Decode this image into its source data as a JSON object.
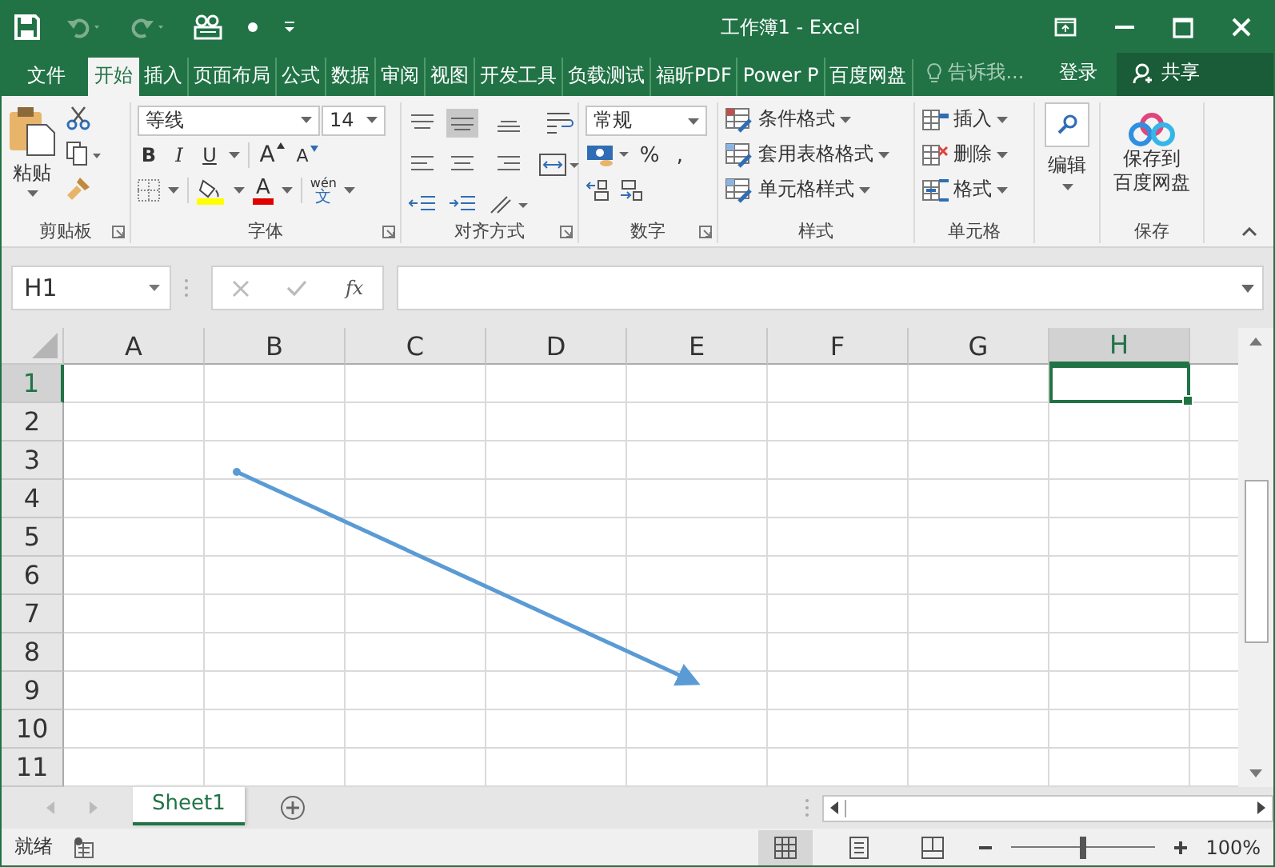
{
  "window": {
    "title": "工作簿1 - Excel"
  },
  "menu_tabs": [
    {
      "label": "文件",
      "selected": false
    },
    {
      "label": "开始",
      "selected": true
    },
    {
      "label": "插入",
      "selected": false
    },
    {
      "label": "页面布局",
      "selected": false
    },
    {
      "label": "公式",
      "selected": false
    },
    {
      "label": "数据",
      "selected": false
    },
    {
      "label": "审阅",
      "selected": false
    },
    {
      "label": "视图",
      "selected": false
    },
    {
      "label": "开发工具",
      "selected": false
    },
    {
      "label": "负载测试",
      "selected": false
    },
    {
      "label": "福昕PDF",
      "selected": false
    },
    {
      "label": "Power P",
      "selected": false
    },
    {
      "label": "百度网盘",
      "selected": false
    }
  ],
  "tell_me": {
    "placeholder": "告诉我..."
  },
  "sign_in": "登录",
  "share": "共享",
  "ribbon": {
    "paste": "粘贴",
    "clipboard_label": "剪贴板",
    "font_name": "等线",
    "font_size": "14",
    "font_styles": [
      "B",
      "I",
      "U"
    ],
    "grow_font": "A",
    "shrink_font": "A",
    "font_color": "A",
    "phonetic_top": "wén",
    "phonetic_bottom": "文",
    "font_label": "字体",
    "alignment_label": "对齐方式",
    "number_format": "常规",
    "percent": "%",
    "comma": ",",
    "number_label": "数字",
    "styles": [
      "条件格式",
      "套用表格格式",
      "单元格样式"
    ],
    "styles_label": "样式",
    "cells": [
      "插入",
      "删除",
      "格式"
    ],
    "cells_label": "单元格",
    "editing": "编辑",
    "save_lines": [
      "保存到",
      "百度网盘"
    ],
    "save_label": "保存"
  },
  "name_box": "H1",
  "fx": "fx",
  "columns": [
    {
      "label": "A",
      "selected": false
    },
    {
      "label": "B",
      "selected": false
    },
    {
      "label": "C",
      "selected": false
    },
    {
      "label": "D",
      "selected": false
    },
    {
      "label": "E",
      "selected": false
    },
    {
      "label": "F",
      "selected": false
    },
    {
      "label": "G",
      "selected": false
    },
    {
      "label": "H",
      "selected": true
    }
  ],
  "rows": [
    {
      "label": "1",
      "selected": true
    },
    {
      "label": "2",
      "selected": false
    },
    {
      "label": "3",
      "selected": false
    },
    {
      "label": "4",
      "selected": false
    },
    {
      "label": "5",
      "selected": false
    },
    {
      "label": "6",
      "selected": false
    },
    {
      "label": "7",
      "selected": false
    },
    {
      "label": "8",
      "selected": false
    },
    {
      "label": "9",
      "selected": false
    },
    {
      "label": "10",
      "selected": false
    },
    {
      "label": "11",
      "selected": false
    }
  ],
  "sheet_tabs": [
    {
      "label": "Sheet1",
      "selected": true
    }
  ],
  "status_bar": {
    "text": "就绪",
    "zoom": "100%",
    "zoom_level": {
      "level": 0.5
    }
  }
}
